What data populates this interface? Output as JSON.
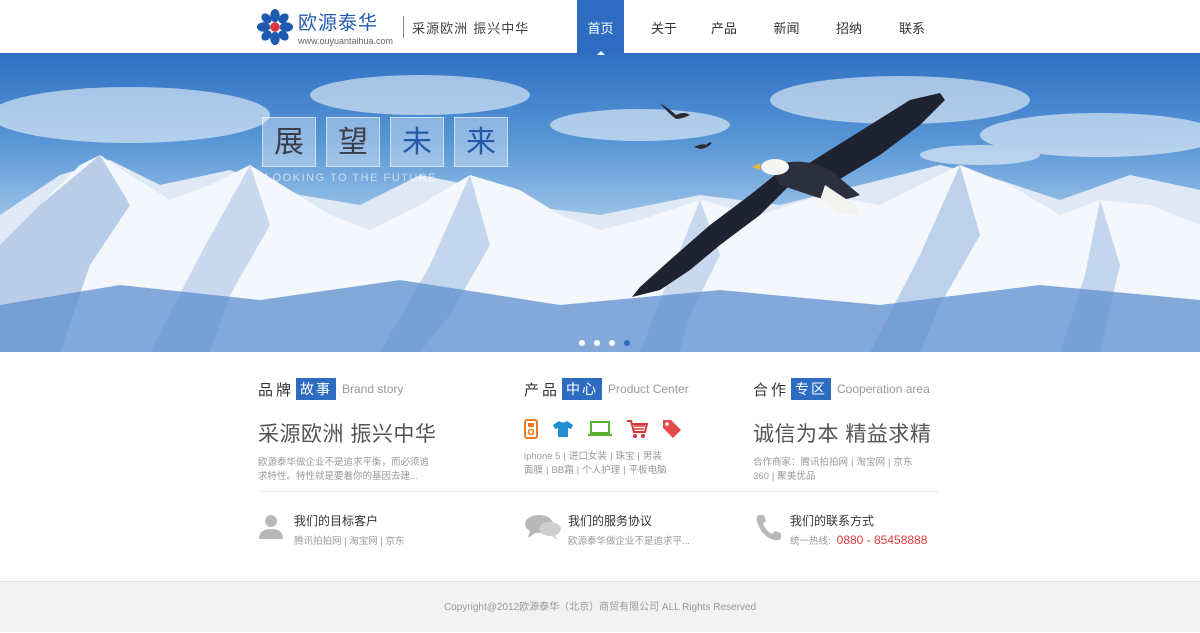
{
  "brand": {
    "name": "欧源泰华",
    "url": "www.ouyuantaihua.com",
    "slogan": "采源欧洲 振兴中华",
    "colors": {
      "primary": "#2d6cc0",
      "accent_red": "#e23b3b"
    }
  },
  "nav": {
    "items": [
      {
        "label": "首页",
        "active": true
      },
      {
        "label": "关于"
      },
      {
        "label": "产品"
      },
      {
        "label": "新闻"
      },
      {
        "label": "招纳"
      },
      {
        "label": "联系"
      }
    ]
  },
  "banner": {
    "title_chars": [
      "展",
      "望",
      "未",
      "来"
    ],
    "subtitle": "LOOKING TO THE FUTURE",
    "slide_count": 4,
    "current_slide": 4
  },
  "sections": {
    "brand_story": {
      "cn": "品牌",
      "tag": "故事",
      "en": "Brand story",
      "headline": "采源欧洲 振兴中华",
      "text": "欧源泰华做企业不是追求平衡，而必须追求特性。特性就是要着你的基因去建..."
    },
    "product_center": {
      "cn": "产品",
      "tag": "中心",
      "en": "Product Center",
      "icons": [
        "mp3-player-icon",
        "tshirt-icon",
        "laptop-icon",
        "shopping-cart-icon",
        "price-tag-icon"
      ],
      "line1": [
        "iphone 5",
        "进口女装",
        "珠宝",
        "男装"
      ],
      "line2": [
        "面膜",
        "BB霜",
        "个人护理",
        "平板电脑"
      ]
    },
    "cooperation": {
      "cn": "合作",
      "tag": "专区",
      "en": "Cooperation area",
      "headline": "诚信为本 精益求精",
      "partners_label": "合作商家：",
      "partners_line1": [
        "腾讯拍拍网",
        "淘宝网",
        "京东"
      ],
      "partners_line2": [
        "360",
        "聚美优品"
      ]
    }
  },
  "services": {
    "customers": {
      "title": "我们的目标客户",
      "text": "腾讯拍拍网 | 淘宝网 | 京东"
    },
    "agreement": {
      "title": "我们的服务协议",
      "text": "欧源泰华做企业不是追求平..."
    },
    "contact": {
      "title": "我们的联系方式",
      "label": "统一热线:",
      "phone": "0880 - 85458888"
    }
  },
  "footer": {
    "copyright": "Copyright@2012欧源泰华（北京）商贸有限公司 ALL Rights Reserved"
  }
}
